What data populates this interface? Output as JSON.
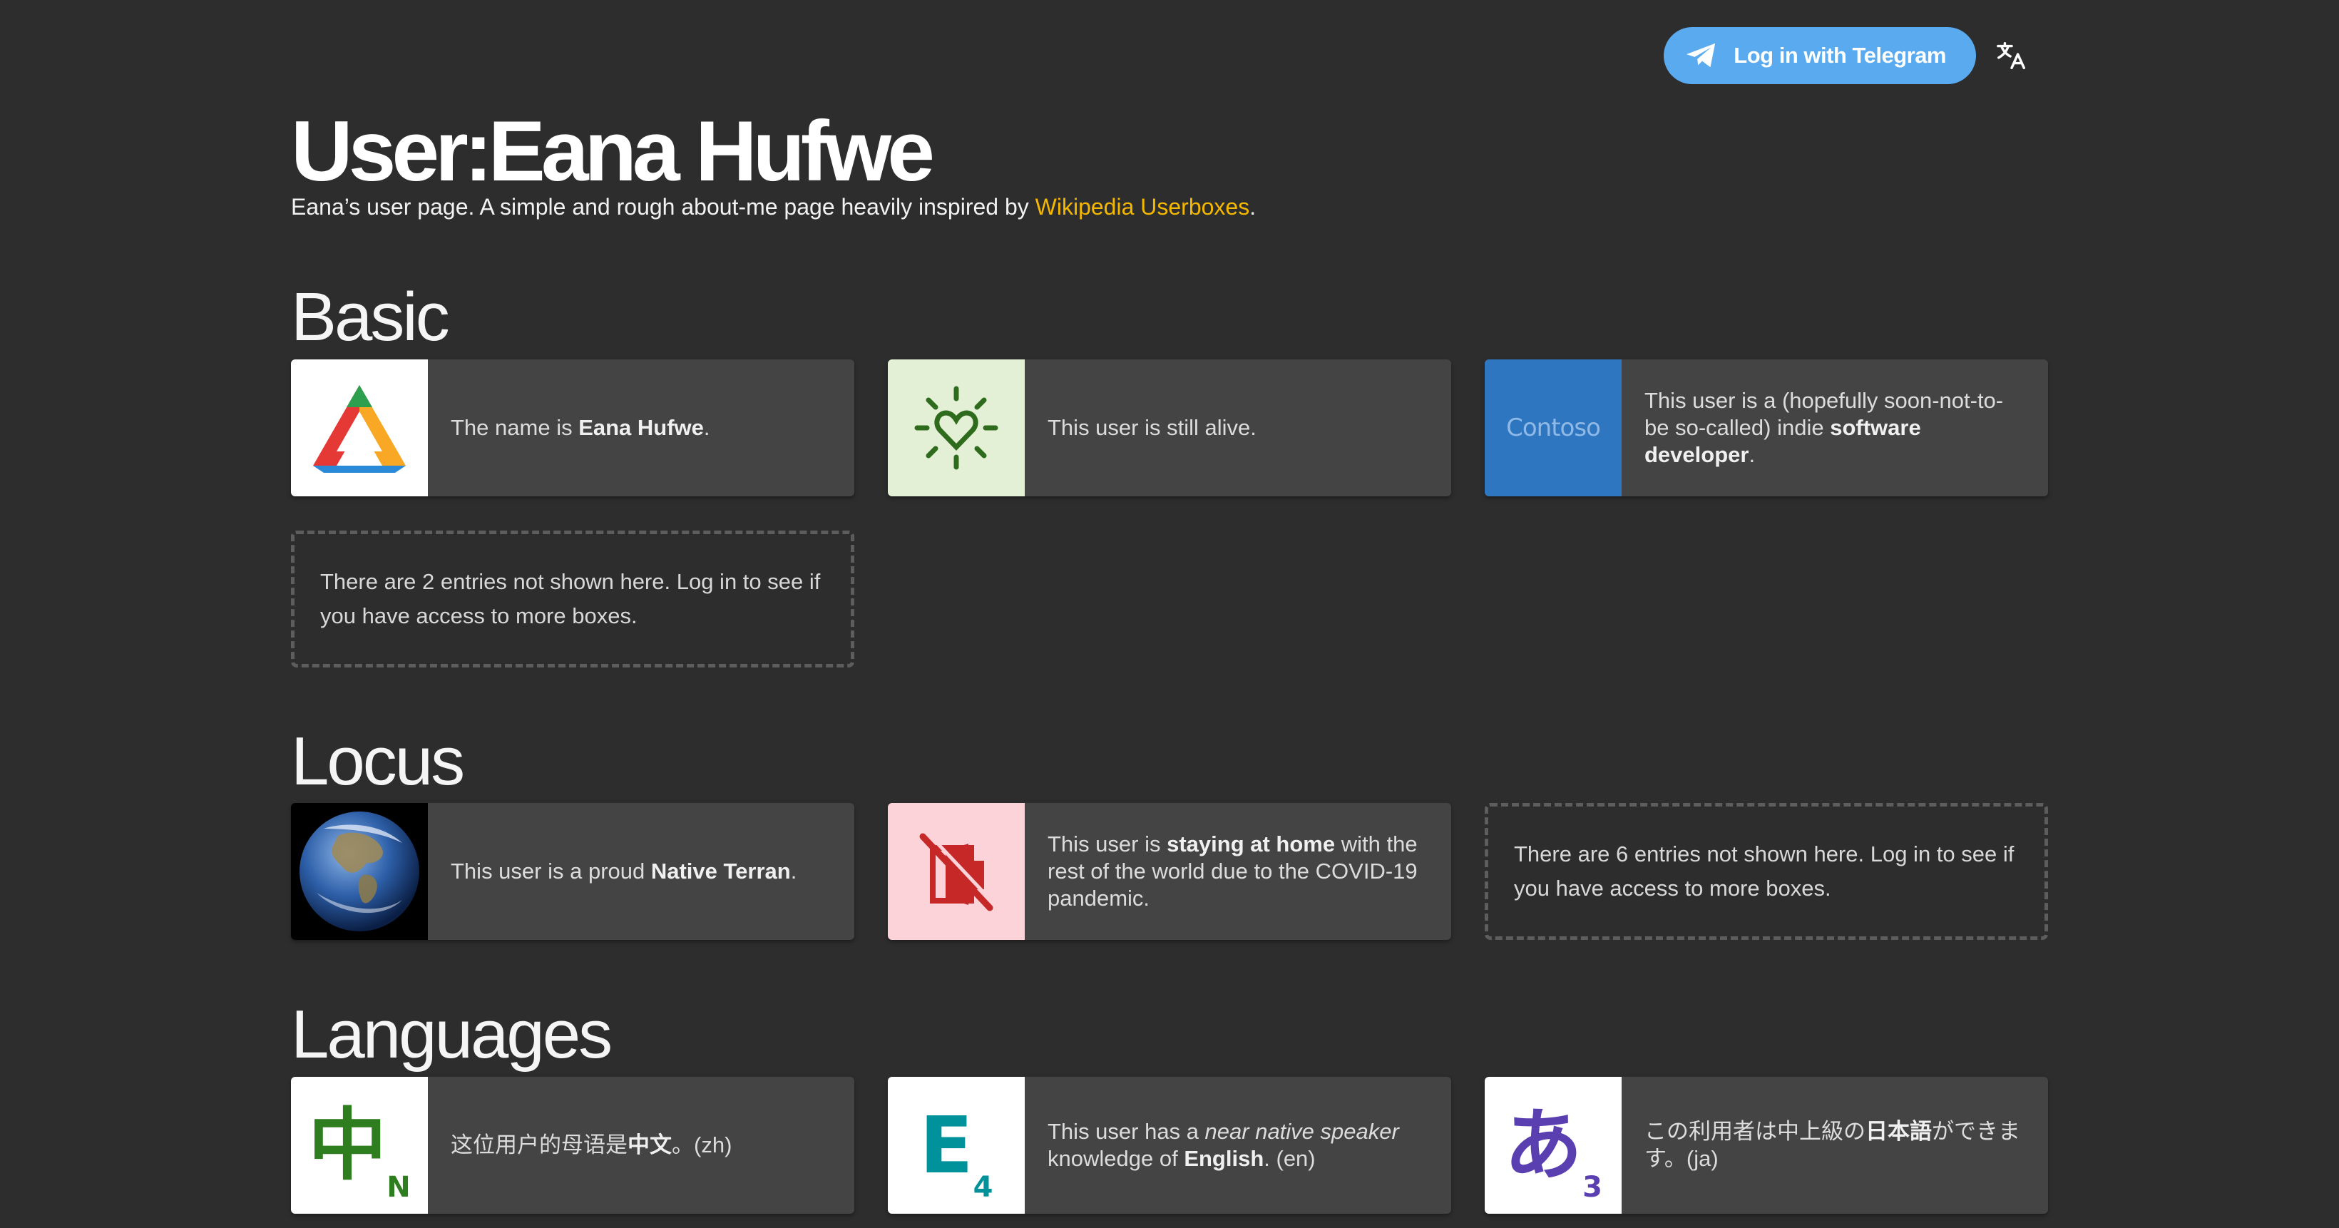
{
  "header": {
    "login_label": "Log in with Telegram",
    "translate_icon": "translate-icon",
    "telegram_icon": "telegram-icon"
  },
  "page": {
    "title": "User:Eana Hufwe",
    "subtitle_prefix": "Eana’s user page. A simple and rough about-me page heavily inspired by ",
    "subtitle_link": "Wikipedia Userboxes",
    "subtitle_suffix": "."
  },
  "sections": {
    "basic": {
      "title": "Basic",
      "boxes": [
        {
          "pre": "The name is ",
          "bold": "Eana Hufwe",
          "post": ".",
          "icon": "triangle-logo-icon"
        },
        {
          "pre": "This user is still alive.",
          "icon": "heart-sun-icon"
        },
        {
          "pre": "This user is a (hopefully soon-not-to-be so-called) indie ",
          "bold": "software developer",
          "post": ".",
          "icon": "contoso-logo-icon",
          "icon_text": "Contoso"
        }
      ],
      "hidden_note": "There are 2 entries not shown here. Log in to see if you have access to more boxes."
    },
    "locus": {
      "title": "Locus",
      "boxes": [
        {
          "pre": "This user is a proud ",
          "bold": "Native Terran",
          "post": ".",
          "icon": "earth-icon"
        },
        {
          "pre": "This user is ",
          "bold": "staying at home",
          "post": " with the rest of the world due to the COVID-19 pandemic.",
          "icon": "no-exit-icon"
        }
      ],
      "hidden_note": "There are 6 entries not shown here. Log in to see if you have access to more boxes."
    },
    "languages": {
      "title": "Languages",
      "boxes": [
        {
          "pre": "这位用户的母语是",
          "bold": "中文",
          "post": "。(zh)",
          "icon": "zh-native-icon",
          "glyph": "中",
          "level": "N"
        },
        {
          "pre": "This user has a ",
          "italic": "near native speaker",
          "mid": " knowledge of ",
          "bold": "English",
          "post": ". (en)",
          "icon": "en-level-4-icon",
          "glyph": "E",
          "level": "4"
        },
        {
          "pre": "この利用者は中上級の",
          "bold": "日本語",
          "post": "ができます。(ja)",
          "icon": "ja-level-3-icon",
          "glyph": "あ",
          "level": "3"
        }
      ]
    }
  },
  "colors": {
    "background": "#2d2d2d",
    "card": "#444444",
    "link": "#f5b800",
    "telegram": "#5aaaf0"
  }
}
